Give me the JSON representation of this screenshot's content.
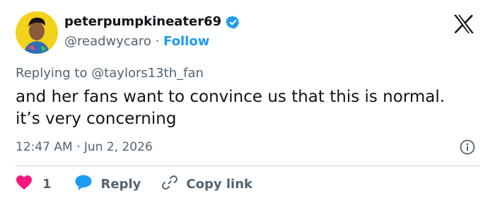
{
  "user": {
    "display_name": "peterpumpkineater69",
    "handle": "@readwycaro",
    "separator": "·",
    "follow_label": "Follow",
    "avatar_icon": "user-avatar",
    "verified_icon": "verified-badge-icon",
    "verified_color": "#1d9bf0"
  },
  "tweet": {
    "replying_to": "Replying to @taylors13th_fan",
    "text": "and her fans want to convince us that this is normal. it’s very concerning",
    "timestamp": "12:47 AM · Jun 2, 2026"
  },
  "actions": {
    "like_count": "1",
    "reply_label": "Reply",
    "copy_label": "Copy link"
  },
  "colors": {
    "like": "#f91880",
    "reply": "#1d9bf0",
    "muted": "#536471",
    "accent": "#1d9bf0"
  }
}
